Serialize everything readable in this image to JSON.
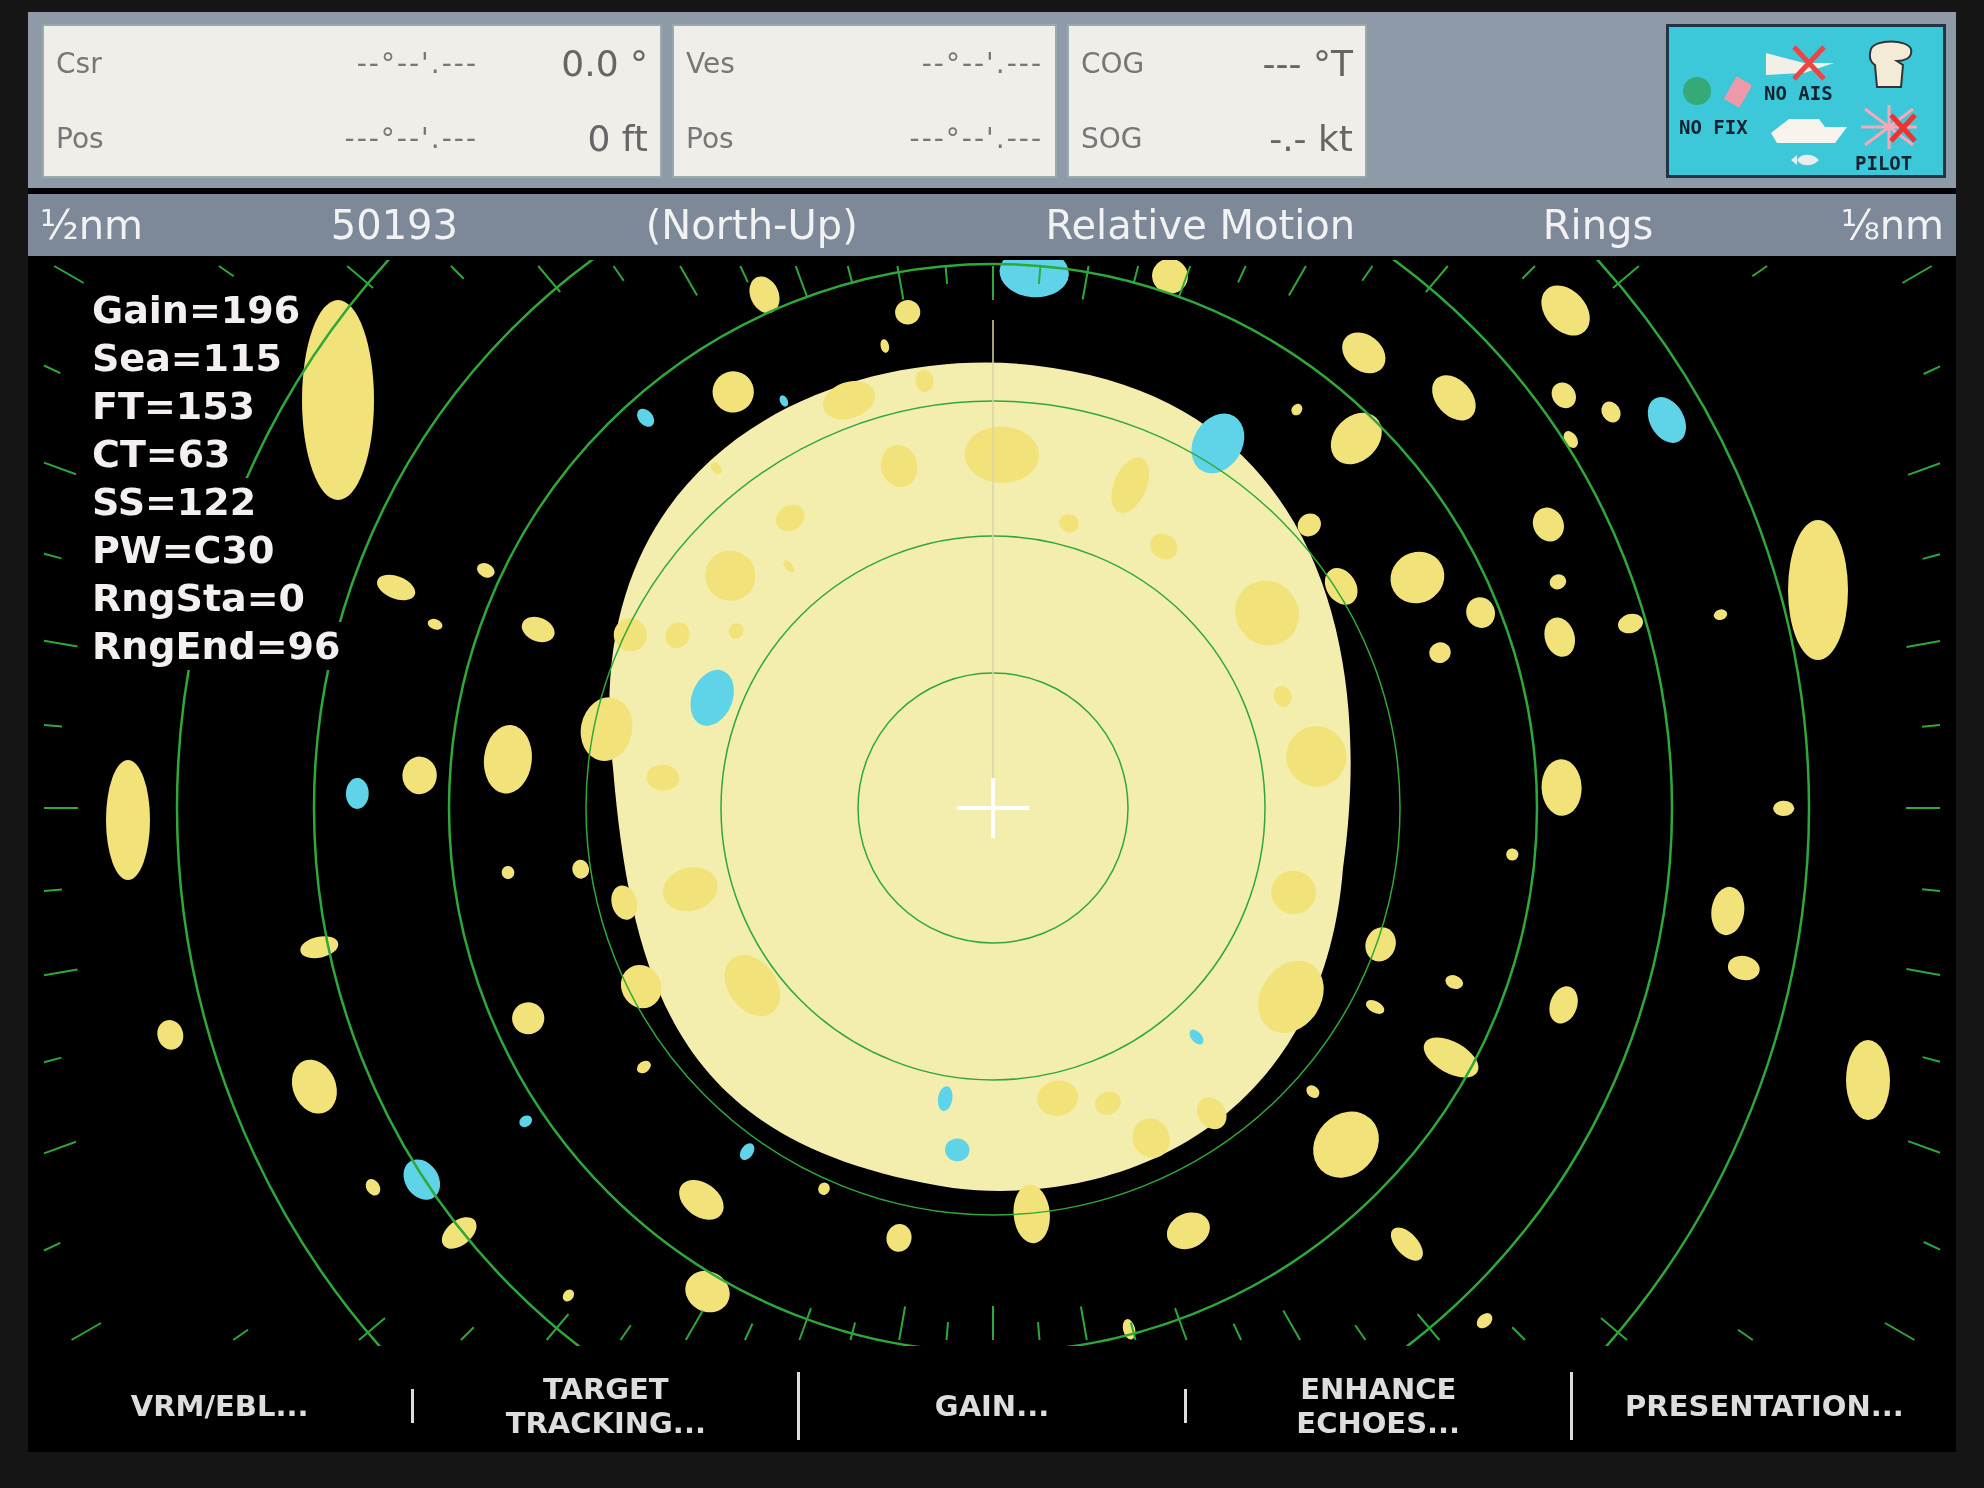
{
  "info_panels": [
    {
      "rows": [
        {
          "label": "Csr",
          "position": "--°--'.---",
          "value": "0.0 °"
        },
        {
          "label": "Pos",
          "position": "---°--'.---",
          "value": "0 ft"
        }
      ]
    },
    {
      "rows": [
        {
          "label": "Ves",
          "position": "--°--'.---"
        },
        {
          "label": "Pos",
          "position": "---°--'.---"
        }
      ]
    },
    {
      "rows": [
        {
          "label": "COG",
          "value": "--- °T"
        },
        {
          "label": "SOG",
          "value": "-.- kt"
        }
      ]
    }
  ],
  "status_icons": [
    {
      "kind": "gps",
      "label": "NO FIX"
    },
    {
      "kind": "ais",
      "label": "NO AIS"
    },
    {
      "kind": "pilot",
      "label": "PILOT"
    }
  ],
  "header": [
    "½nm",
    "50193",
    "(North-Up)",
    "Relative Motion",
    "Rings",
    "⅛nm"
  ],
  "readouts": [
    "Gain=196",
    "Sea=115",
    "FT=153",
    "CT=63",
    "SS=122",
    "PW=C30",
    "RngSta=0",
    "RngEnd=96"
  ],
  "softkeys": [
    {
      "lines": [
        "VRM/EBL..."
      ]
    },
    {
      "lines": [
        "TARGET",
        "TRACKING..."
      ]
    },
    {
      "lines": [
        "GAIN..."
      ]
    },
    {
      "lines": [
        "ENHANCE",
        "ECHOES..."
      ]
    },
    {
      "lines": [
        "PRESENTATION..."
      ]
    }
  ]
}
